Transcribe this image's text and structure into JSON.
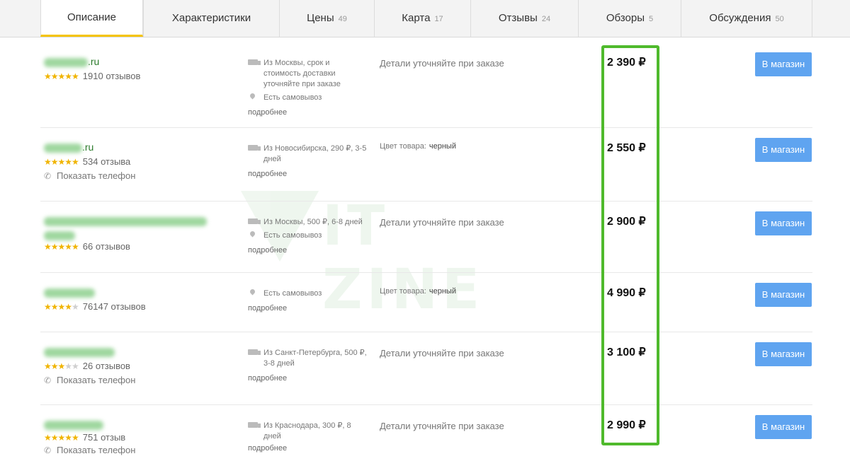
{
  "tabs": [
    {
      "label": "Описание",
      "count": ""
    },
    {
      "label": "Характеристики",
      "count": ""
    },
    {
      "label": "Цены",
      "count": "49"
    },
    {
      "label": "Карта",
      "count": "17"
    },
    {
      "label": "Отзывы",
      "count": "24"
    },
    {
      "label": "Обзоры",
      "count": "5"
    },
    {
      "label": "Обсуждения",
      "count": "50"
    }
  ],
  "watermark": "IT ZINE",
  "offers": [
    {
      "shop_suffix": ".ru",
      "stars": 5,
      "reviews": "1910 отзывов",
      "phone": "",
      "delivery": "Из Москвы, срок и стоимость доставки уточняйте при заказе",
      "pickup": "Есть самовывоз",
      "more": "подробнее",
      "details": "Детали уточняйте при заказе",
      "color_label": "",
      "color_value": "",
      "price": "2 390 ₽",
      "button": "В магазин"
    },
    {
      "shop_suffix": ".ru",
      "stars": 5,
      "reviews": "534 отзыва",
      "phone": "Показать телефон",
      "delivery": "Из Новосибирска, 290 ₽, 3-5 дней",
      "pickup": "",
      "more": "подробнее",
      "details": "",
      "color_label": "Цвет товара:",
      "color_value": "черный",
      "price": "2 550 ₽",
      "button": "В магазин"
    },
    {
      "shop_suffix": "",
      "stars": 5,
      "reviews": "66 отзывов",
      "phone": "",
      "delivery": "Из Москвы, 500 ₽, 6-8 дней",
      "pickup": "Есть самовывоз",
      "more": "подробнее",
      "details": "Детали уточняйте при заказе",
      "color_label": "",
      "color_value": "",
      "price": "2 900 ₽",
      "button": "В магазин"
    },
    {
      "shop_suffix": "",
      "stars": 4,
      "reviews": "76147 отзывов",
      "phone": "",
      "delivery": "",
      "pickup": "Есть самовывоз",
      "more": "подробнее",
      "details": "",
      "color_label": "Цвет товара:",
      "color_value": "черный",
      "price": "4 990 ₽",
      "button": "В магазин"
    },
    {
      "shop_suffix": "",
      "stars": 3,
      "reviews": "26 отзывов",
      "phone": "Показать телефон",
      "delivery": "Из Санкт-Петербурга, 500 ₽, 3-8 дней",
      "pickup": "",
      "more": "подробнее",
      "details": "Детали уточняйте при заказе",
      "color_label": "",
      "color_value": "",
      "price": "3 100 ₽",
      "button": "В магазин"
    },
    {
      "shop_suffix": "",
      "stars": 5,
      "reviews": "751 отзыв",
      "phone": "Показать телефон",
      "delivery": "Из Краснодара, 300 ₽, 8 дней",
      "pickup": "",
      "more": "подробнее",
      "details": "Детали уточняйте при заказе",
      "color_label": "",
      "color_value": "",
      "price": "2 990 ₽",
      "button": "В магазин"
    }
  ]
}
